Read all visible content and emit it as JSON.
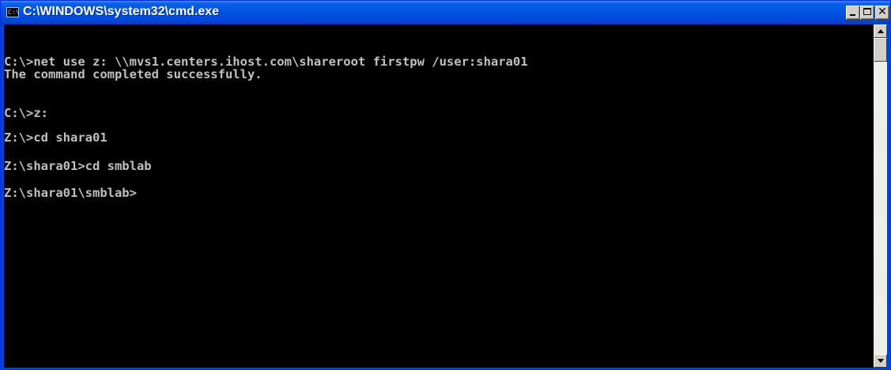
{
  "window": {
    "title": "C:\\WINDOWS\\system32\\cmd.exe",
    "icon_text": "C:\\",
    "controls": {
      "minimize_icon": "minimize-icon",
      "maximize_icon": "maximize-icon",
      "close_icon": "close-icon",
      "close_glyph": "✕"
    }
  },
  "console": {
    "lines": [
      "C:\\>net use z: \\\\mvs1.centers.ihost.com\\shareroot firstpw /user:shara01",
      "The command completed successfully.",
      "C:\\>z:",
      "Z:\\>cd shara01",
      "Z:\\shara01>cd smblab",
      "Z:\\shara01\\smblab>"
    ],
    "text_color": "#c0c0c0",
    "background_color": "#000000"
  },
  "colors": {
    "titlebar": "#0055e5",
    "button_face": "#d4d0c8"
  }
}
